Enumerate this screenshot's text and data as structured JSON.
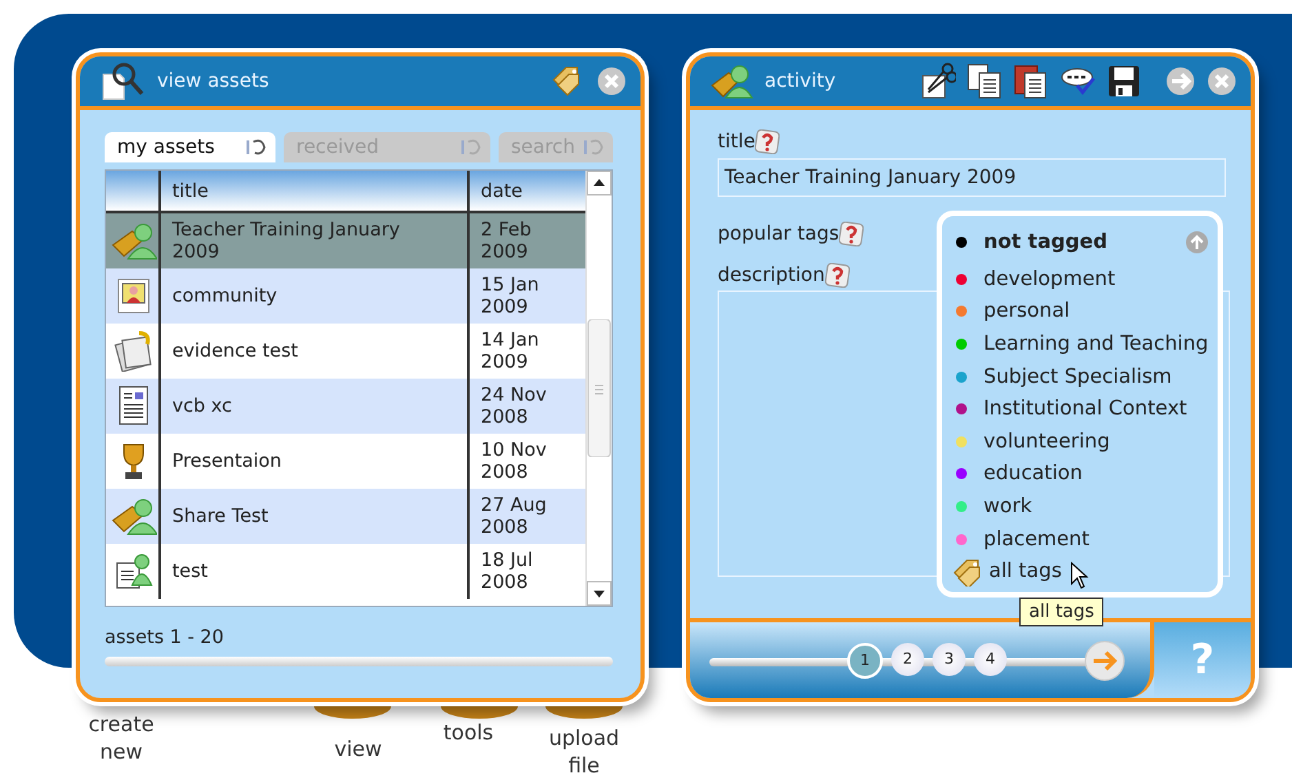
{
  "assets_window": {
    "title": "view assets",
    "tabs": [
      {
        "label": "my assets",
        "selected": true
      },
      {
        "label": "received",
        "selected": false
      },
      {
        "label": "search",
        "selected": false
      }
    ],
    "table": {
      "columns": [
        "title",
        "date"
      ],
      "rows": [
        {
          "kind": "shared",
          "title": "Teacher Training January 2009",
          "date": "2 Feb 2009",
          "selected": true
        },
        {
          "kind": "photo",
          "title": "community",
          "date": "15 Jan 2009",
          "selected": false
        },
        {
          "kind": "evidence",
          "title": "evidence test",
          "date": "14 Jan 2009",
          "selected": false
        },
        {
          "kind": "document",
          "title": "vcb xc",
          "date": "24 Nov 2008",
          "selected": false
        },
        {
          "kind": "award",
          "title": "Presentaion",
          "date": "10 Nov 2008",
          "selected": false
        },
        {
          "kind": "shared",
          "title": "Share Test",
          "date": "27 Aug 2008",
          "selected": false
        },
        {
          "kind": "group",
          "title": "test",
          "date": "18 Jul 2008",
          "selected": false
        }
      ]
    },
    "footer": "assets 1 - 20"
  },
  "activity_window": {
    "title": "activity",
    "title_label": "title",
    "title_value": "Teacher Training January 2009",
    "popular_tags_label": "popular tags",
    "description_label": "description",
    "tag_menu": {
      "items": [
        {
          "label": "not tagged",
          "color": "#000000",
          "selected": true
        },
        {
          "label": "development",
          "color": "#ee0033",
          "selected": false
        },
        {
          "label": "personal",
          "color": "#f47a30",
          "selected": false
        },
        {
          "label": "Learning and Teaching",
          "color": "#00cc00",
          "selected": false
        },
        {
          "label": "Subject Specialism",
          "color": "#1aa3cc",
          "selected": false
        },
        {
          "label": "Institutional Context",
          "color": "#b0128a",
          "selected": false
        },
        {
          "label": "volunteering",
          "color": "#f0e060",
          "selected": false
        },
        {
          "label": "education",
          "color": "#9900ff",
          "selected": false
        },
        {
          "label": "work",
          "color": "#33ee88",
          "selected": false
        },
        {
          "label": "placement",
          "color": "#ff66cc",
          "selected": false
        }
      ],
      "all_tags": "all tags"
    },
    "tooltip": "all tags",
    "steps": [
      {
        "label": "1",
        "selected": true
      },
      {
        "label": "2",
        "selected": false
      },
      {
        "label": "3",
        "selected": false
      },
      {
        "label": "4",
        "selected": false
      }
    ],
    "help": "?"
  },
  "desktop_items": [
    "create new",
    "view",
    "tools",
    "upload file"
  ]
}
